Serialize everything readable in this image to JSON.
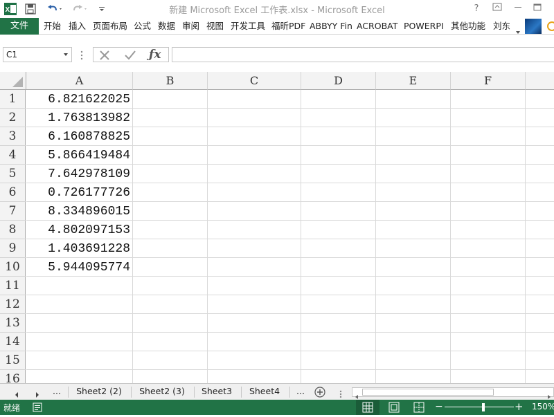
{
  "window": {
    "title": "新建 Microsoft Excel 工作表.xlsx - Microsoft Excel",
    "help": "?"
  },
  "ribbon": {
    "file_tab": "文件",
    "tabs": [
      "开始",
      "插入",
      "页面布局",
      "公式",
      "数据",
      "审阅",
      "视图",
      "开发工具",
      "福昕PDF",
      "ABBYY Fin",
      "ACROBAT",
      "POWERPI",
      "其他功能"
    ],
    "user": "刘东"
  },
  "formula_bar": {
    "name_box": "C1",
    "formula": ""
  },
  "grid": {
    "columns": [
      "A",
      "B",
      "C",
      "D",
      "E",
      "F"
    ],
    "rows": [
      "1",
      "2",
      "3",
      "4",
      "5",
      "6",
      "7",
      "8",
      "9",
      "10",
      "11",
      "12",
      "13",
      "14",
      "15",
      "16"
    ],
    "column_a_values": [
      "6.821622025",
      "1.763813982",
      "6.160878825",
      "5.866419484",
      "7.642978109",
      "0.726177726",
      "8.334896015",
      "4.802097153",
      "1.403691228",
      "5.944095774"
    ]
  },
  "sheet_tabs": {
    "ellipsis_left": "...",
    "tabs": [
      "Sheet2 (2)",
      "Sheet2 (3)",
      "Sheet3",
      "Sheet4"
    ],
    "ellipsis_right": "..."
  },
  "status": {
    "ready": "就绪",
    "zoom": "150%"
  },
  "colors": {
    "excel_green": "#217346",
    "header_bg": "#f3f3f3",
    "gridline": "#d9d9d9"
  }
}
